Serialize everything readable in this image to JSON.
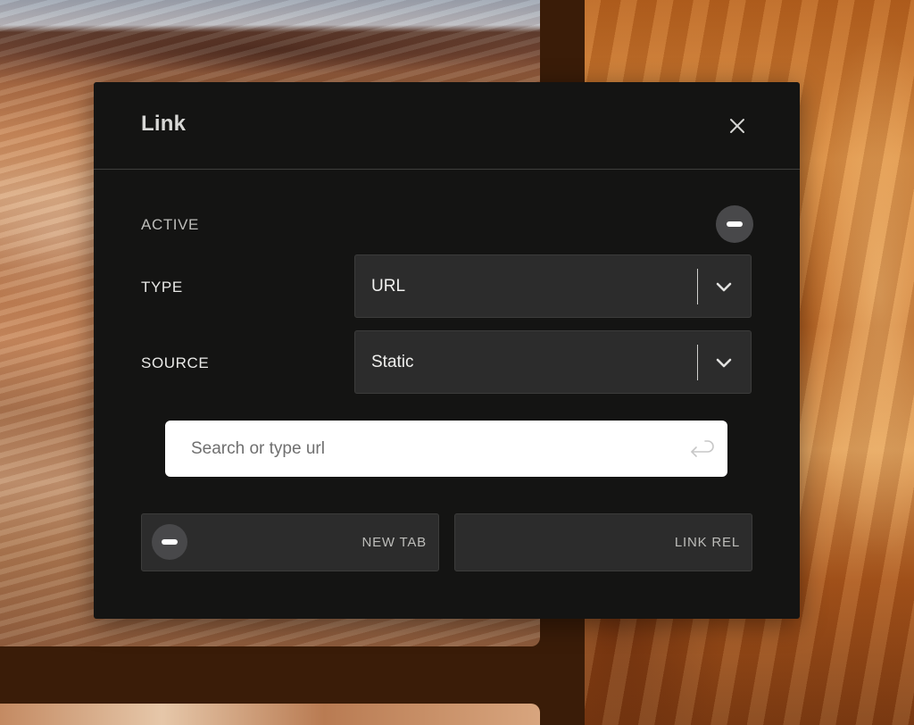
{
  "dialog": {
    "title": "Link",
    "close_icon": "close-icon"
  },
  "fields": {
    "active": {
      "label": "ACTIVE",
      "toggle_icon": "minus-icon"
    },
    "type": {
      "label": "TYPE",
      "value": "URL",
      "icon": "chevron-down-icon"
    },
    "source": {
      "label": "SOURCE",
      "value": "Static",
      "icon": "chevron-down-icon"
    },
    "url": {
      "placeholder": "Search or type url",
      "value": "",
      "icon": "enter-return-icon"
    }
  },
  "options": {
    "new_tab": {
      "label": "NEW TAB",
      "toggle_icon": "minus-icon"
    },
    "link_rel": {
      "label": "LINK REL"
    }
  },
  "colors": {
    "modal_bg": "#141413",
    "field_bg": "#2c2c2c",
    "toggle_bg": "#48484a",
    "page_bg": "#3a1c08"
  }
}
